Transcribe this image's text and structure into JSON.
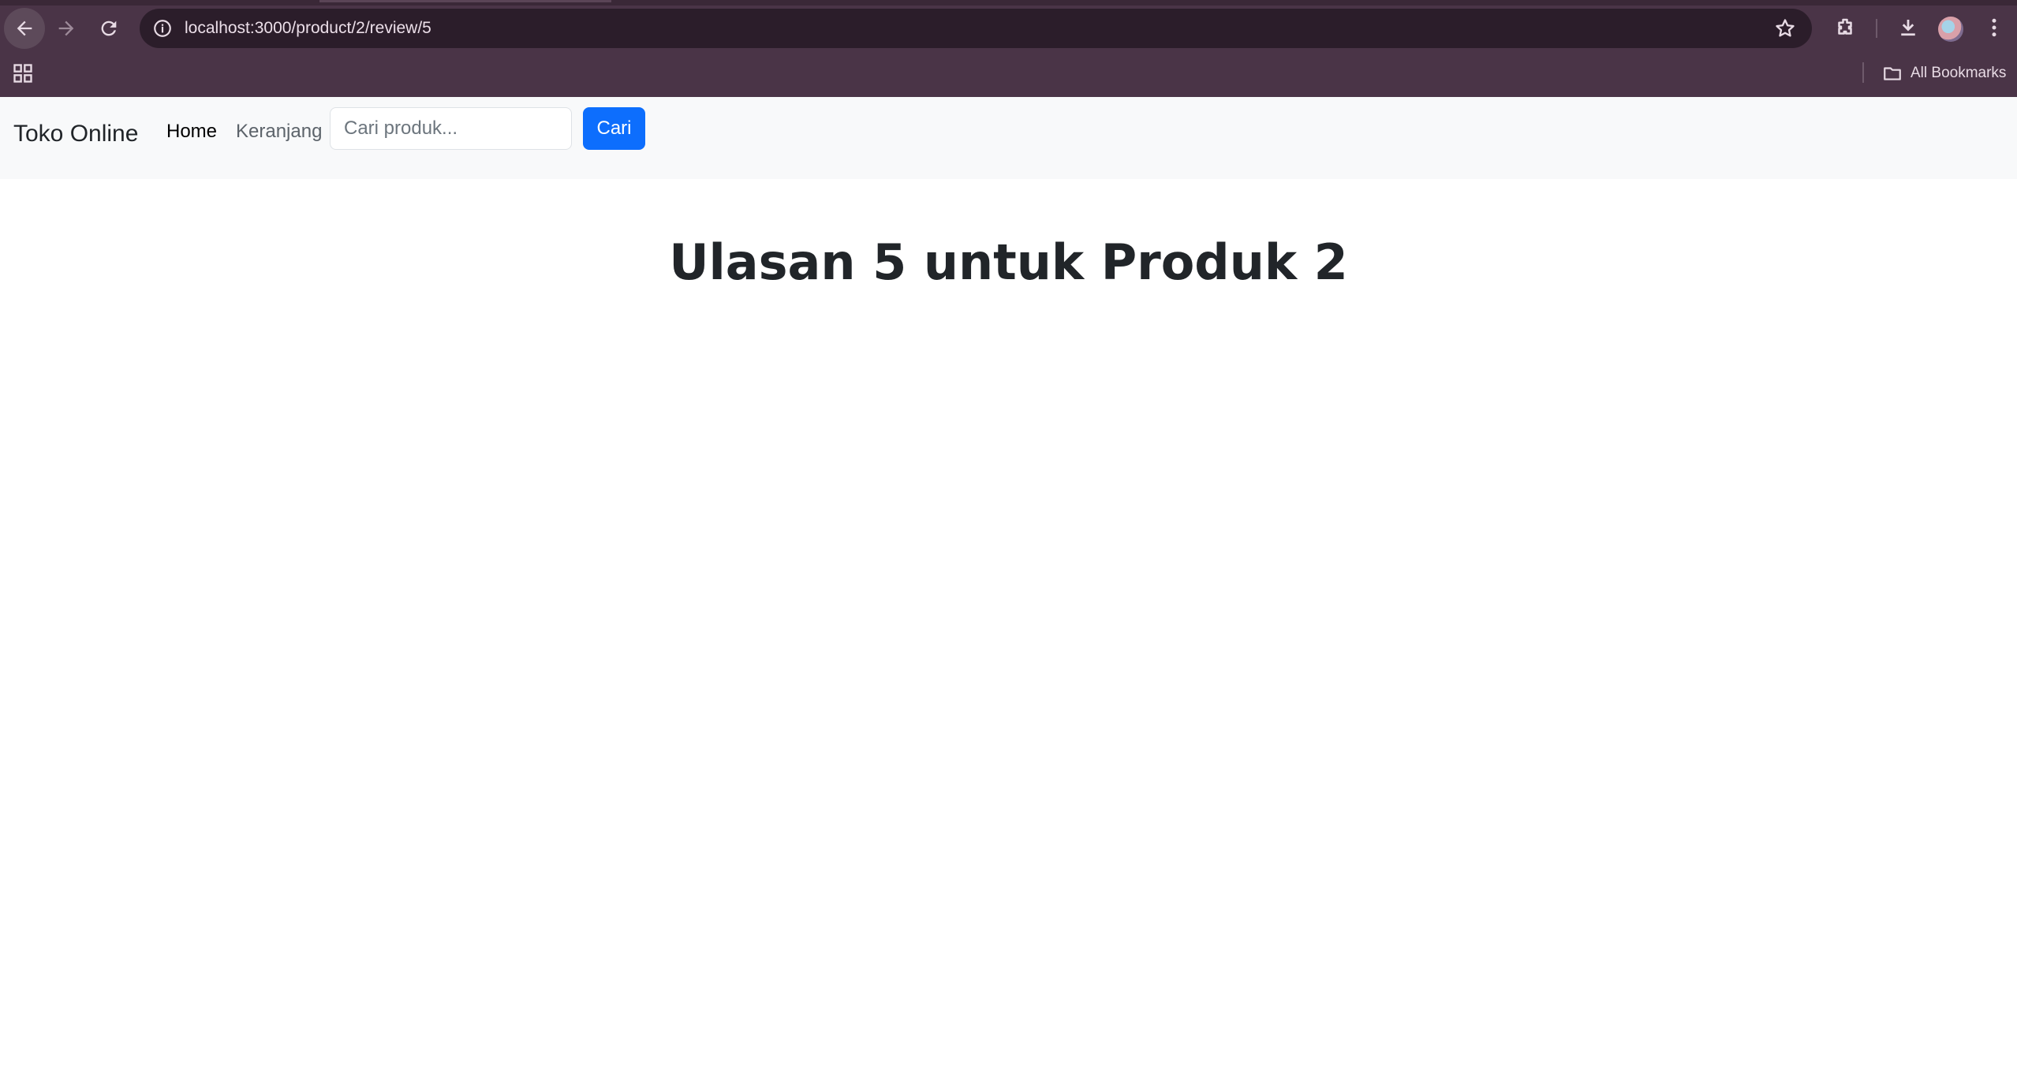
{
  "browser": {
    "url": "localhost:3000/product/2/review/5",
    "bookmarks_label": "All Bookmarks",
    "icons": [
      "back-icon",
      "forward-icon",
      "reload-icon",
      "site-info-icon",
      "star-icon",
      "extensions-icon",
      "download-icon",
      "profile-avatar",
      "menu-icon",
      "apps-icon",
      "folder-icon"
    ]
  },
  "navbar": {
    "brand": "Toko Online",
    "links": [
      {
        "label": "Home"
      },
      {
        "label": "Keranjang"
      }
    ],
    "search": {
      "placeholder": "Cari produk...",
      "value": ""
    },
    "search_button": "Cari"
  },
  "main": {
    "title": "Ulasan 5 untuk Produk 2"
  },
  "colors": {
    "chrome": "#4a3447",
    "omnibox": "#2b1d2a",
    "navbar_bg": "#f8f9fa",
    "primary": "#0d6efd",
    "text": "#212529",
    "muted_link": "#5c636a"
  }
}
